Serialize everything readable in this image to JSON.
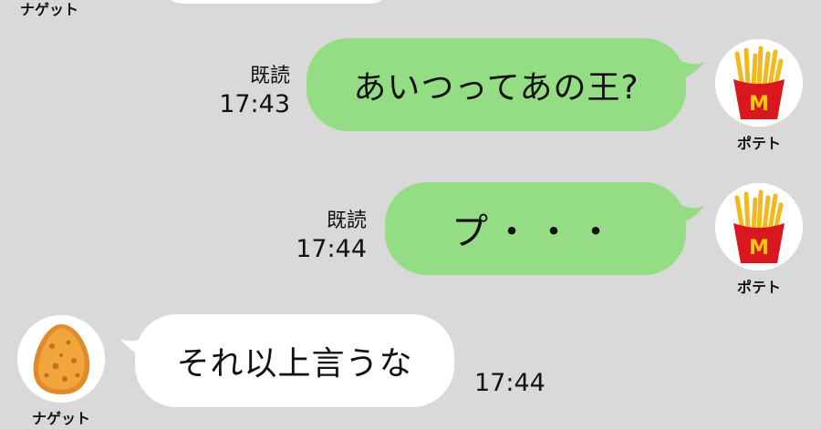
{
  "colors": {
    "background": "#d9d9d9",
    "outgoing_bubble": "#95dd84",
    "incoming_bubble": "#ffffff"
  },
  "top_partial": {
    "sender_name": "ナゲット"
  },
  "messages": [
    {
      "direction": "outgoing",
      "text": "あいつってあの王?",
      "read_label": "既読",
      "time": "17:43",
      "sender_name": "ポテト",
      "avatar_icon": "french-fries-icon"
    },
    {
      "direction": "outgoing",
      "text": "プ・・・",
      "read_label": "既読",
      "time": "17:44",
      "sender_name": "ポテト",
      "avatar_icon": "french-fries-icon"
    },
    {
      "direction": "incoming",
      "text": "それ以上言うな",
      "time": "17:44",
      "sender_name": "ナゲット",
      "avatar_icon": "chicken-nugget-icon"
    }
  ]
}
